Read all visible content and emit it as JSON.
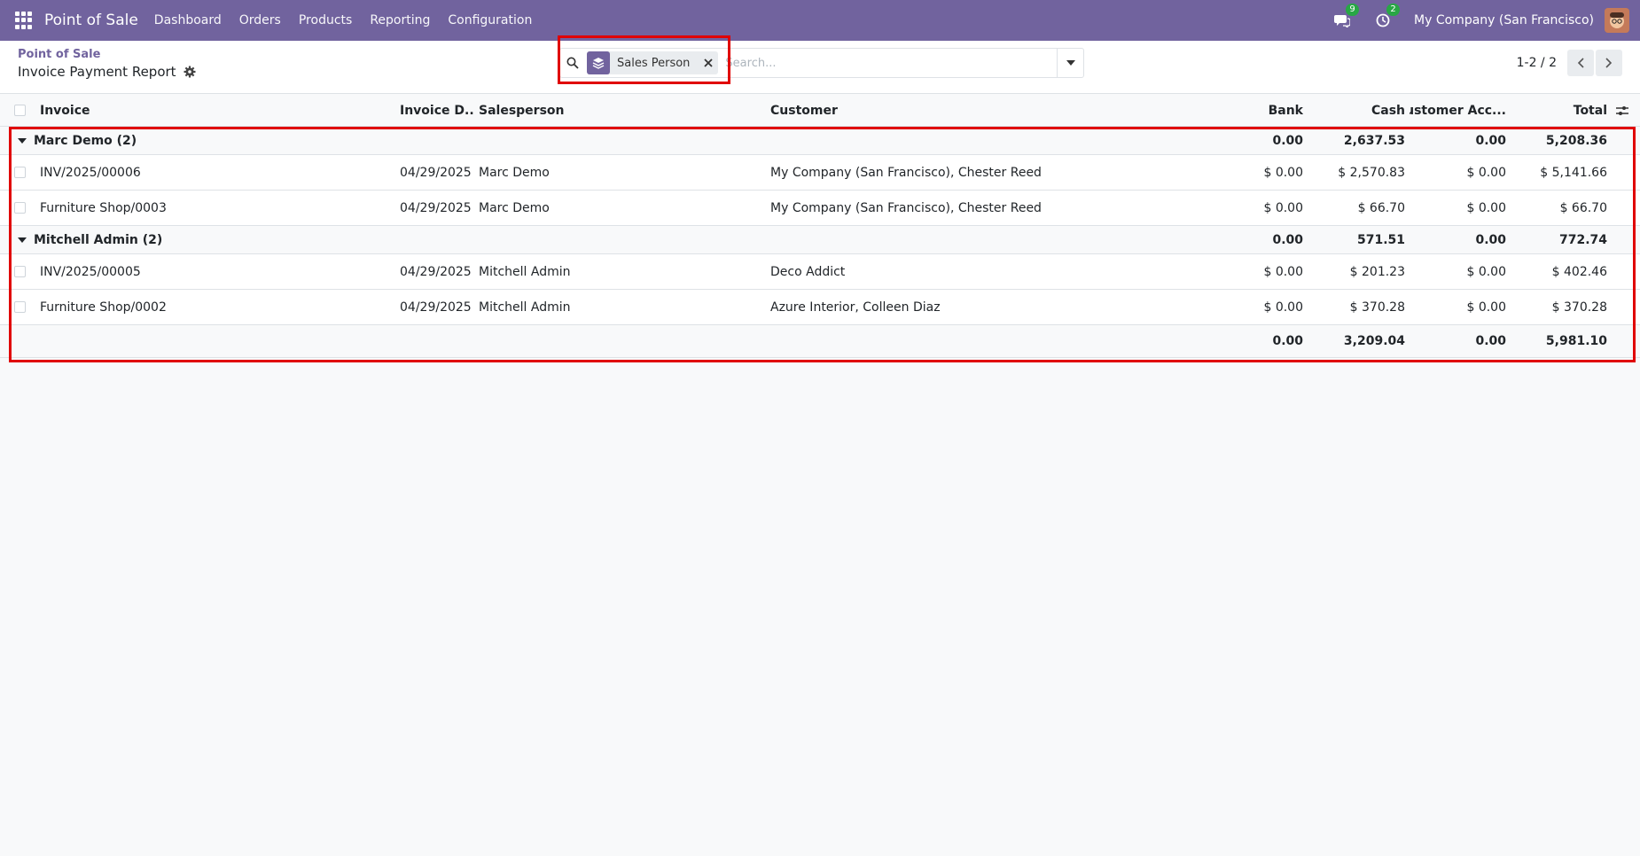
{
  "navbar": {
    "app_name": "Point of Sale",
    "menu": [
      "Dashboard",
      "Orders",
      "Products",
      "Reporting",
      "Configuration"
    ],
    "messages_count": "9",
    "activities_count": "2",
    "company": "My Company (San Francisco)"
  },
  "control_panel": {
    "breadcrumb_parent": "Point of Sale",
    "title": "Invoice Payment Report",
    "search": {
      "facet_label": "Sales Person",
      "placeholder": "Search..."
    },
    "pager": "1-2 / 2"
  },
  "table": {
    "columns": {
      "invoice": "Invoice",
      "date": "Invoice D...",
      "salesperson": "Salesperson",
      "customer": "Customer",
      "bank": "Bank",
      "cash": "Cash",
      "account": "Customer Acc...",
      "total": "Total"
    },
    "groups": [
      {
        "label": "Marc Demo (2)",
        "bank": "0.00",
        "cash": "2,637.53",
        "account": "0.00",
        "total": "5,208.36",
        "rows": [
          {
            "invoice": "INV/2025/00006",
            "date": "04/29/2025",
            "salesperson": "Marc Demo",
            "customer": "My Company (San Francisco), Chester Reed",
            "bank": "$ 0.00",
            "cash": "$ 2,570.83",
            "account": "$ 0.00",
            "total": "$ 5,141.66"
          },
          {
            "invoice": "Furniture Shop/0003",
            "date": "04/29/2025",
            "salesperson": "Marc Demo",
            "customer": "My Company (San Francisco), Chester Reed",
            "bank": "$ 0.00",
            "cash": "$ 66.70",
            "account": "$ 0.00",
            "total": "$ 66.70"
          }
        ]
      },
      {
        "label": "Mitchell Admin (2)",
        "bank": "0.00",
        "cash": "571.51",
        "account": "0.00",
        "total": "772.74",
        "rows": [
          {
            "invoice": "INV/2025/00005",
            "date": "04/29/2025",
            "salesperson": "Mitchell Admin",
            "customer": "Deco Addict",
            "bank": "$ 0.00",
            "cash": "$ 201.23",
            "account": "$ 0.00",
            "total": "$ 402.46"
          },
          {
            "invoice": "Furniture Shop/0002",
            "date": "04/29/2025",
            "salesperson": "Mitchell Admin",
            "customer": "Azure Interior, Colleen Diaz",
            "bank": "$ 0.00",
            "cash": "$ 370.28",
            "account": "$ 0.00",
            "total": "$ 370.28"
          }
        ]
      }
    ],
    "totals": {
      "bank": "0.00",
      "cash": "3,209.04",
      "account": "0.00",
      "total": "5,981.10"
    }
  },
  "colors": {
    "brand": "#71639e",
    "highlight": "#e00000",
    "badge": "#28a745"
  }
}
